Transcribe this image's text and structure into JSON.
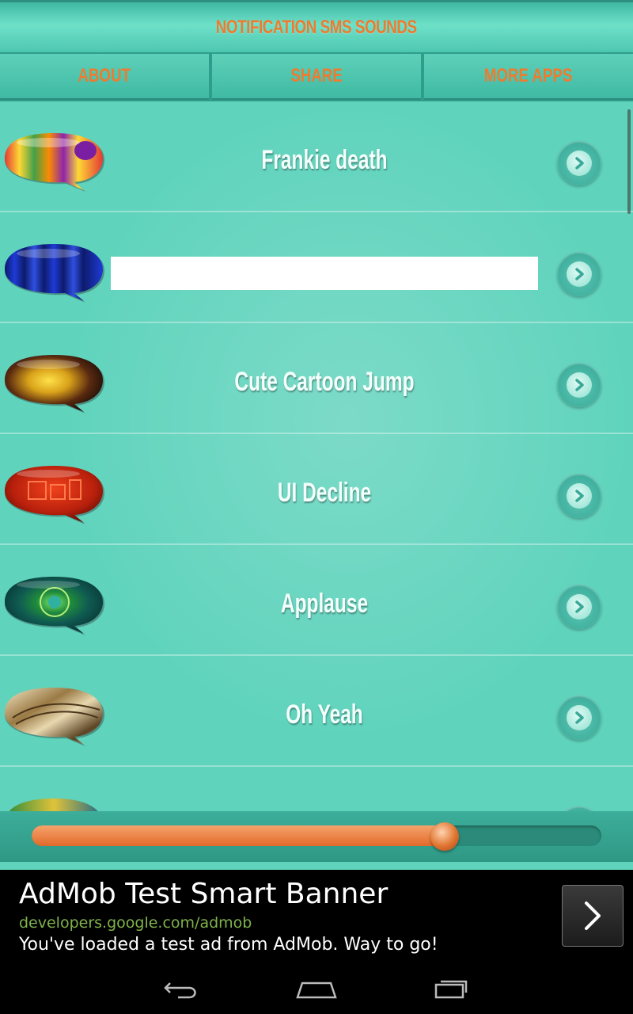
{
  "header": {
    "title": "NOTIFICATION SMS SOUNDS"
  },
  "tabs": [
    {
      "label": "ABOUT"
    },
    {
      "label": "SHARE"
    },
    {
      "label": "MORE APPS"
    }
  ],
  "sounds": [
    {
      "label": "Frankie death",
      "bubble": "rainbow-stripes"
    },
    {
      "label": "",
      "bubble": "blue-stripes"
    },
    {
      "label": "Cute Cartoon Jump",
      "bubble": "fire-texture"
    },
    {
      "label": "UI Decline",
      "bubble": "red-squares"
    },
    {
      "label": "Applause",
      "bubble": "green-mandala"
    },
    {
      "label": "Oh Yeah",
      "bubble": "gold-swirl"
    },
    {
      "label": "",
      "bubble": "peacock-pattern"
    }
  ],
  "player": {
    "progress": 0.725
  },
  "ad": {
    "title": "AdMob Test Smart Banner",
    "url": "developers.google.com/admob",
    "text": "You've loaded a test ad from AdMob. Way to go!"
  },
  "navbar": {
    "icons": [
      "back-icon",
      "home-icon",
      "recents-icon"
    ]
  },
  "colors": {
    "accent_orange": "#ee7b2f",
    "background_teal": "#5fd3bc"
  }
}
